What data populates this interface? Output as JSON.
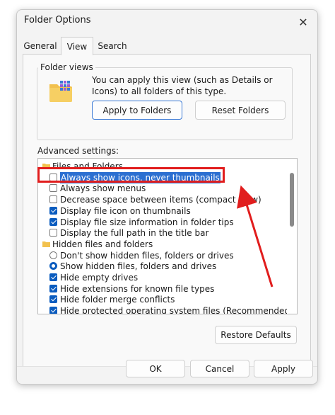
{
  "window": {
    "title": "Folder Options",
    "close_glyph": "✕"
  },
  "tabs": [
    {
      "label": "General",
      "active": false
    },
    {
      "label": "View",
      "active": true
    },
    {
      "label": "Search",
      "active": false
    }
  ],
  "folder_views": {
    "label": "Folder views",
    "description": "You can apply this view (such as Details or Icons) to all folders of this type.",
    "apply_button": "Apply to Folders",
    "reset_button": "Reset Folders",
    "icon": "folder-view-icon"
  },
  "advanced": {
    "label": "Advanced settings:",
    "items": [
      {
        "type": "folder",
        "label": "Files and Folders"
      },
      {
        "type": "checkbox",
        "checked": false,
        "selected": true,
        "label": "Always show icons, never thumbnails"
      },
      {
        "type": "checkbox",
        "checked": false,
        "label": "Always show menus"
      },
      {
        "type": "checkbox",
        "checked": false,
        "label": "Decrease space between items (compact view)"
      },
      {
        "type": "checkbox",
        "checked": true,
        "label": "Display file icon on thumbnails"
      },
      {
        "type": "checkbox",
        "checked": true,
        "label": "Display file size information in folder tips"
      },
      {
        "type": "checkbox",
        "checked": false,
        "label": "Display the full path in the title bar"
      },
      {
        "type": "folder",
        "label": "Hidden files and folders"
      },
      {
        "type": "radio",
        "checked": false,
        "label": "Don't show hidden files, folders or drives"
      },
      {
        "type": "radio",
        "checked": true,
        "label": "Show hidden files, folders and drives"
      },
      {
        "type": "checkbox",
        "checked": true,
        "label": "Hide empty drives"
      },
      {
        "type": "checkbox",
        "checked": true,
        "label": "Hide extensions for known file types"
      },
      {
        "type": "checkbox",
        "checked": true,
        "label": "Hide folder merge conflicts"
      },
      {
        "type": "checkbox",
        "checked": true,
        "label": "Hide protected operating system files (Recommended)"
      }
    ],
    "restore_button": "Restore Defaults"
  },
  "footer": {
    "ok": "OK",
    "cancel": "Cancel",
    "apply": "Apply"
  },
  "colors": {
    "accent": "#0b5cbf",
    "selection": "#2b6fd1",
    "annotation": "#e11d1d",
    "folder": "#f2c14e"
  }
}
